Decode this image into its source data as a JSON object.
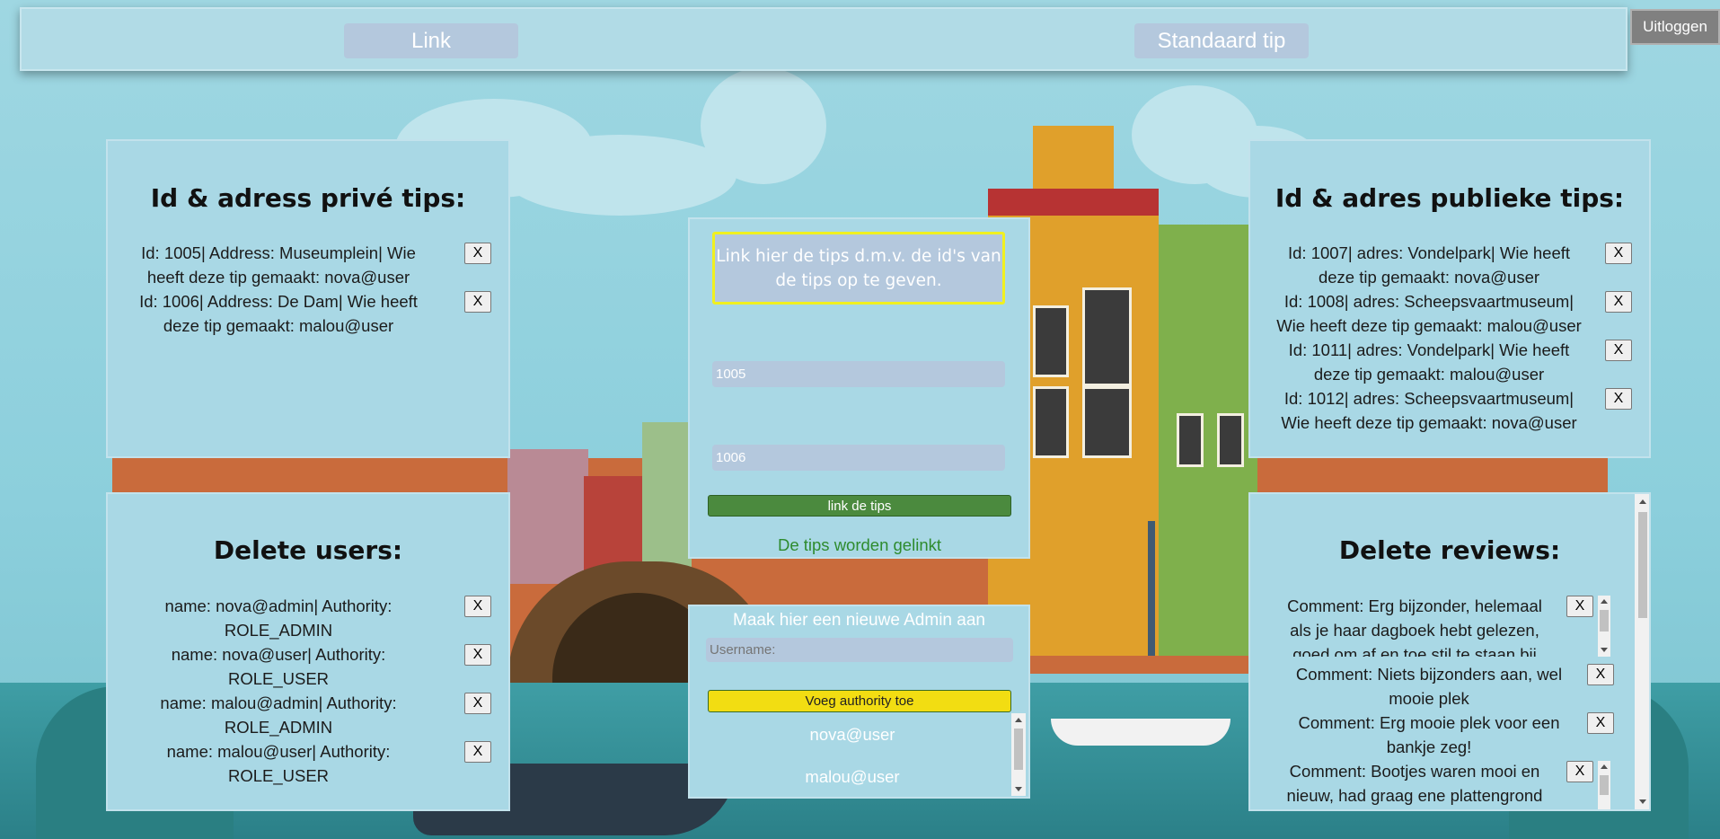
{
  "header": {
    "link_label": "Link",
    "standard_tip_label": "Standaard tip",
    "logout_label": "Uitloggen"
  },
  "private_tips": {
    "title": "Id & adress privé tips:",
    "items": [
      {
        "line1": "Id: 1005| Address: Museumplein| Wie",
        "line2": "heeft deze tip gemaakt: nova@user",
        "remove": "X"
      },
      {
        "line1": "Id: 1006| Address: De Dam| Wie heeft",
        "line2": "deze tip gemaakt: malou@user",
        "remove": "X"
      }
    ]
  },
  "link_panel": {
    "instruction": "Link hier de tips d.m.v. de id's van de tips op te geven.",
    "first_id": "1005",
    "second_id": "1006",
    "button_label": "link de tips",
    "status": "De tips worden gelinkt"
  },
  "public_tips": {
    "title": "Id & adres publieke tips:",
    "items": [
      {
        "line1": "Id: 1007| adres: Vondelpark| Wie heeft",
        "line2": "deze tip gemaakt: nova@user",
        "remove": "X"
      },
      {
        "line1": "Id: 1008| adres: Scheepsvaartmuseum|",
        "line2": "Wie heeft deze tip gemaakt: malou@user",
        "remove": "X"
      },
      {
        "line1": "Id: 1011| adres: Vondelpark| Wie heeft",
        "line2": "deze tip gemaakt: malou@user",
        "remove": "X"
      },
      {
        "line1": "Id: 1012| adres: Scheepsvaartmuseum|",
        "line2": "Wie heeft deze tip gemaakt: nova@user",
        "remove": "X"
      }
    ]
  },
  "delete_users": {
    "title": "Delete users:",
    "items": [
      {
        "line1": "name: nova@admin| Authority:",
        "line2": "ROLE_ADMIN",
        "remove": "X"
      },
      {
        "line1": "name: nova@user| Authority:",
        "line2": "ROLE_USER",
        "remove": "X"
      },
      {
        "line1": "name: malou@admin| Authority:",
        "line2": "ROLE_ADMIN",
        "remove": "X"
      },
      {
        "line1": "name: malou@user| Authority:",
        "line2": "ROLE_USER",
        "remove": "X"
      }
    ]
  },
  "new_admin": {
    "title": "Maak hier een nieuwe Admin aan",
    "username_placeholder": "Username:",
    "button_label": "Voeg authority toe",
    "users": [
      "nova@user",
      "malou@user"
    ]
  },
  "delete_reviews": {
    "title": "Delete reviews:",
    "items": [
      {
        "line1": "Comment: Erg bijzonder, helemaal",
        "line2": "als je haar dagboek hebt gelezen,",
        "line3": "goed om af en toe stil te staan bij",
        "remove": "X"
      },
      {
        "line1": "Comment: Niets bijzonders aan, wel",
        "line2": "mooie plek",
        "remove": "X"
      },
      {
        "line1": "Comment: Erg mooie plek voor een",
        "line2": "bankje zeg!",
        "remove": "X"
      },
      {
        "line1": "Comment: Bootjes waren mooi en",
        "line2": "nieuw, had graag ene plattengrond",
        "remove": "X"
      }
    ]
  },
  "colors": {
    "panel": "#a9d8e5",
    "input": "#b4c8dd",
    "link_button": "#4b8a3e",
    "authority_button": "#f2dd12",
    "status_text": "#2e8b2e",
    "instruction_border": "#f0f020"
  }
}
